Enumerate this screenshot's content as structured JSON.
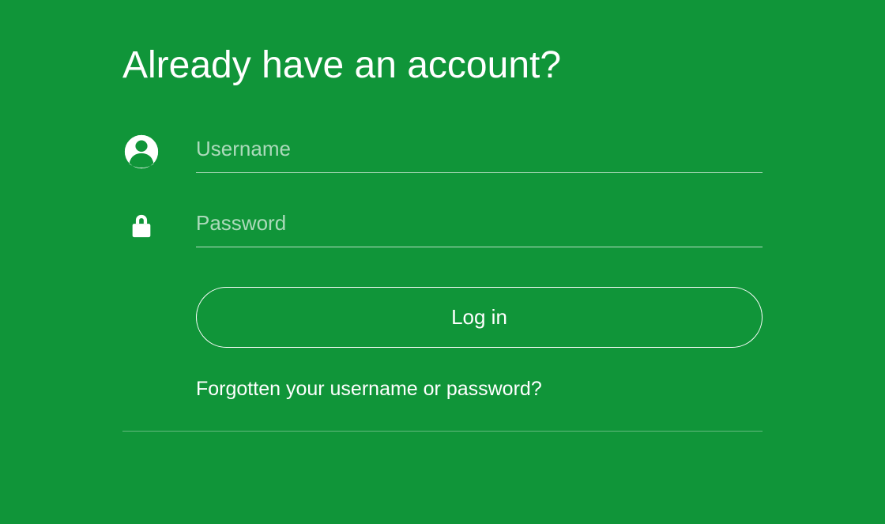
{
  "heading": "Already have an account?",
  "username": {
    "placeholder": "Username",
    "value": ""
  },
  "password": {
    "placeholder": "Password",
    "value": ""
  },
  "login_button_label": "Log in",
  "forgot_link_label": "Forgotten your username or password?",
  "colors": {
    "background": "#109539",
    "text": "#ffffff"
  }
}
